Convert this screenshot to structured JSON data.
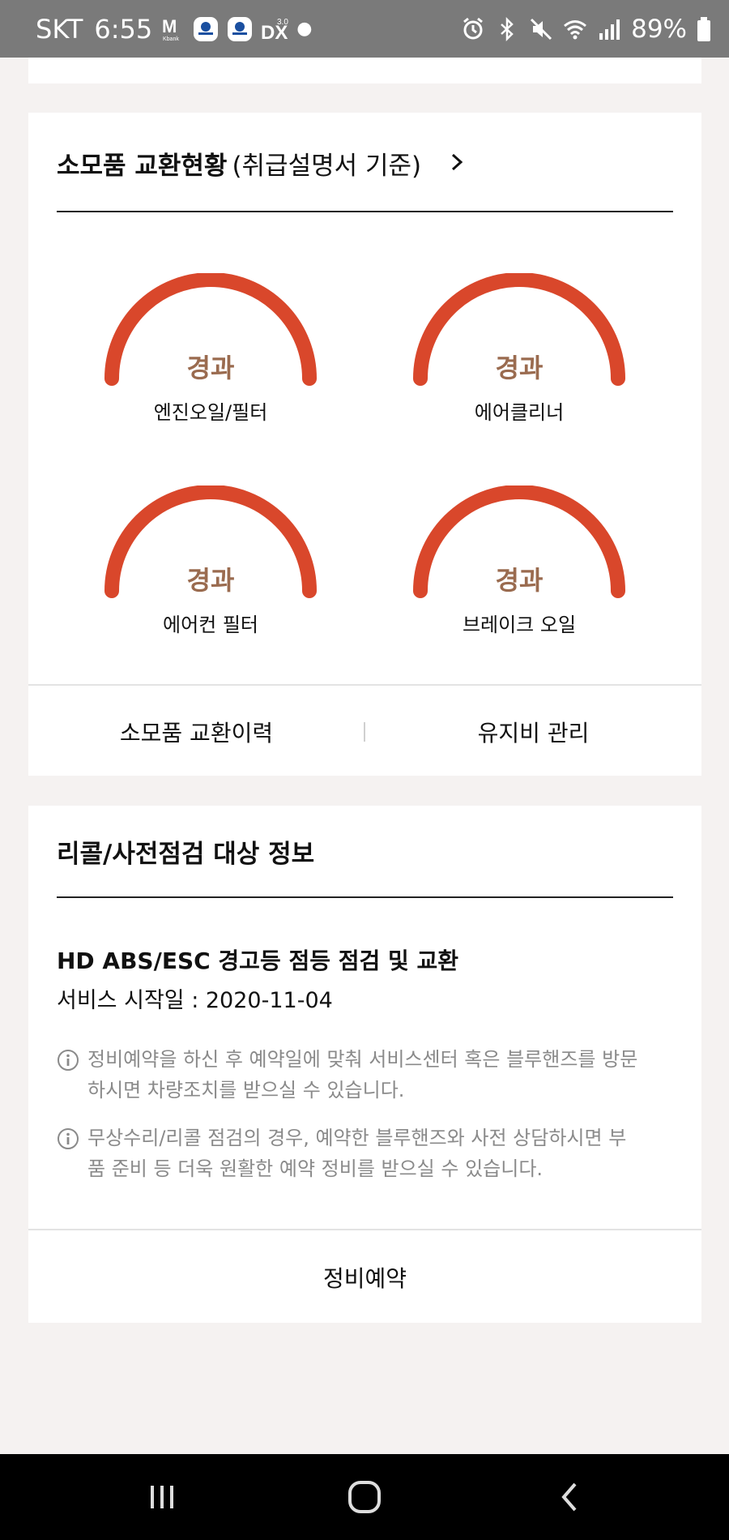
{
  "status_bar": {
    "carrier": "SKT",
    "time": "6:55",
    "notif_icons": [
      "kbank-icon",
      "won-icon",
      "won-icon",
      "dx-icon"
    ],
    "battery": "89%"
  },
  "consumables": {
    "title": "소모품 교환현황",
    "subtitle": "(취급설명서 기준)",
    "items": [
      {
        "status": "경과",
        "label": "엔진오일/필터"
      },
      {
        "status": "경과",
        "label": "에어클리너"
      },
      {
        "status": "경과",
        "label": "에어컨 필터"
      },
      {
        "status": "경과",
        "label": "브레이크 오일"
      }
    ],
    "history_button": "소모품 교환이력",
    "maintenance_button": "유지비 관리",
    "gauge_color": "#d9472b"
  },
  "recall": {
    "title": "리콜/사전점검 대상 정보",
    "item_title": "HD ABS/ESC 경고등 점등 점검 및 교환",
    "service_start": "서비스 시작일 : 2020-11-04",
    "notices": [
      "정비예약을 하신 후 예약일에 맞춰 서비스센터 혹은 블루핸즈를 방문하시면 차량조치를 받으실 수 있습니다.",
      "무상수리/리콜 점검의 경우, 예약한 블루핸즈와 사전 상담하시면 부품 준비 등 더욱 원활한 예약 정비를 받으실 수 있습니다."
    ],
    "reserve_button": "정비예약"
  }
}
